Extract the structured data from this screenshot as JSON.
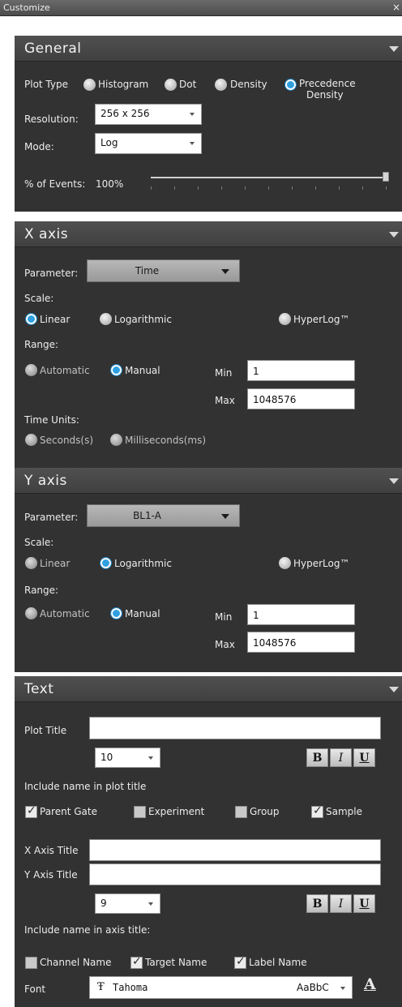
{
  "window": {
    "title": "Customize",
    "close": "×"
  },
  "general": {
    "header": "General",
    "plot_type_label": "Plot Type",
    "plot_types": [
      "Histogram",
      "Dot",
      "Density",
      "Precedence",
      "Density"
    ],
    "selected_plot_type": "Precedence Density",
    "resolution_label": "Resolution:",
    "resolution_value": "256 x 256",
    "mode_label": "Mode:",
    "mode_value": "Log",
    "events_label": "% of Events:",
    "events_value": "100%",
    "events_fraction": 1.0
  },
  "xaxis": {
    "header": "X axis",
    "parameter_label": "Parameter:",
    "parameter_value": "Time",
    "scale_label": "Scale:",
    "scale_options": [
      "Linear",
      "Logarithmic",
      "HyperLog™"
    ],
    "selected_scale": "Linear",
    "range_label": "Range:",
    "range_options": [
      "Automatic",
      "Manual"
    ],
    "selected_range": "Manual",
    "min_label": "Min",
    "min_value": "1",
    "max_label": "Max",
    "max_value": "1048576",
    "time_units_label": "Time Units:",
    "time_units": [
      "Seconds(s)",
      "Milliseconds(ms)"
    ]
  },
  "yaxis": {
    "header": "Y axis",
    "parameter_label": "Parameter:",
    "parameter_value": "BL1-A",
    "scale_label": "Scale:",
    "scale_options": [
      "Linear",
      "Logarithmic",
      "HyperLog™"
    ],
    "selected_scale": "Logarithmic",
    "range_label": "Range:",
    "range_options": [
      "Automatic",
      "Manual"
    ],
    "selected_range": "Manual",
    "min_label": "Min",
    "min_value": "1",
    "max_label": "Max",
    "max_value": "1048576"
  },
  "text": {
    "header": "Text",
    "plot_title_label": "Plot Title",
    "plot_title_value": "",
    "plot_title_size": "10",
    "bold": "B",
    "italic": "I",
    "underline": "U",
    "include_plot_label": "Include name in plot title",
    "plot_checks": [
      {
        "label": "Parent Gate",
        "checked": true
      },
      {
        "label": "Experiment",
        "checked": false
      },
      {
        "label": "Group",
        "checked": false
      },
      {
        "label": "Sample",
        "checked": true
      }
    ],
    "x_axis_title_label": "X Axis Title",
    "y_axis_title_label": "Y Axis Title",
    "axis_title_size": "9",
    "include_axis_label": "Include name in axis title:",
    "axis_checks": [
      {
        "label": "Channel Name",
        "checked": false
      },
      {
        "label": "Target Name",
        "checked": true
      },
      {
        "label": "Label Name",
        "checked": true
      }
    ],
    "font_label": "Font",
    "font_icon": "Ŧ",
    "font_value": "Tahoma",
    "font_preview": "AaBbC",
    "font_color_glyph": "A"
  },
  "colors": {
    "panel_bg": "#323232",
    "header_bg": "#484848",
    "accent_blue": "#2f9fe0"
  }
}
